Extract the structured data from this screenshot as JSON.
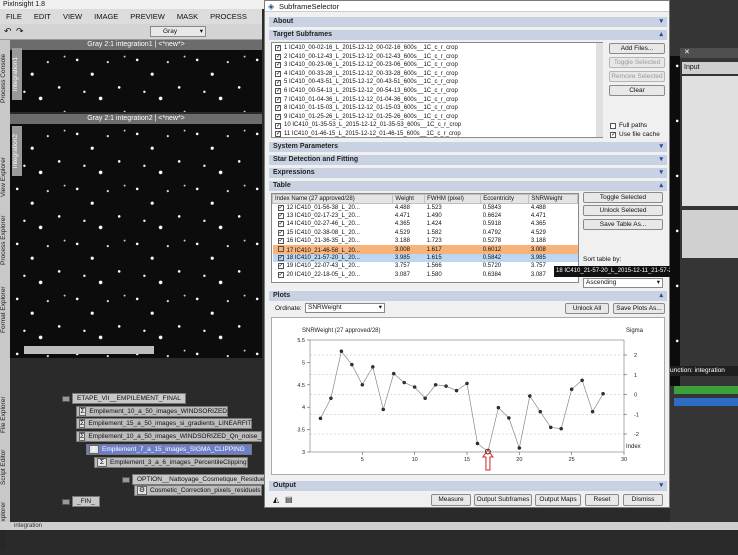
{
  "app": {
    "title": "PixInsight 1.8"
  },
  "menu": [
    "FILE",
    "EDIT",
    "VIEW",
    "IMAGE",
    "PREVIEW",
    "MASK",
    "PROCESS"
  ],
  "toolbar": {
    "colorspace": "Gray"
  },
  "side_tabs": [
    "Process Console",
    "View Explorer",
    "Process Explorer",
    "Format Explorer",
    "File Explorer",
    "Script Editor",
    "History Explorer"
  ],
  "image_windows": [
    {
      "title": "Gray 2:1 integration1 | <*new*>",
      "tab": "integration1"
    },
    {
      "title": "Gray 2:1 integration2 | <*new*>",
      "tab": "integration2"
    }
  ],
  "process_container": {
    "header": "ETAPE_VII__EMPILEMENT_FINAL",
    "items": [
      {
        "label": "Empilement_10_a_50_images_WINDSORIZED"
      },
      {
        "label": "Empilement_15_a_50_images_si_gradients_LINEARFIT"
      },
      {
        "label": "Empilement_10_a_50_images_WINDSORIZED_Qn_noise_"
      },
      {
        "label": "Empilement_7_a_15_images_SIGMA_CLIPPING"
      },
      {
        "label": "Empilement_3_a_6_images_PercentileClipping"
      }
    ],
    "option_header": "OPTION__Nattoyage_Cosmetique_Residuel",
    "option_item": "Cosmetic_Correction_pixels_residuels",
    "fin": "_FIN_"
  },
  "dialog": {
    "title": "SubframeSelector",
    "sections": {
      "about": "About",
      "target": "Target Subframes",
      "params": "System Parameters",
      "star": "Star Detection and Fitting",
      "expr": "Expressions",
      "table": "Table",
      "plots": "Plots",
      "output": "Output"
    },
    "subframes": [
      "1 IC410_00-02-16_L_2015-12-12_00-02-16_600s__1C_c_r_crop",
      "2 IC410_00-12-43_L_2015-12-12_00-12-43_600s__1C_c_r_crop",
      "3 IC410_00-23-06_L_2015-12-12_00-23-06_600s__1C_c_r_crop",
      "4 IC410_00-33-28_L_2015-12-12_00-33-28_600s__1C_c_r_crop",
      "5 IC410_00-43-51_L_2015-12-12_00-43-51_600s__1C_c_r_crop",
      "6 IC410_00-54-13_L_2015-12-12_00-54-13_600s__1C_c_r_crop",
      "7 IC410_01-04-36_L_2015-12-12_01-04-36_600s__1C_c_r_crop",
      "8 IC410_01-15-03_L_2015-12-12_01-15-03_600s__1C_c_r_crop",
      "9 IC410_01-25-26_L_2015-12-12_01-25-26_600s__1C_c_r_crop",
      "10 IC410_01-35-53_L_2015-12-12_01-35-53_600s__1C_c_r_crop",
      "11 IC410_01-46-15_L_2015-12-12_01-46-15_600s__1C_c_r_crop"
    ],
    "buttons": {
      "add_files": "Add Files...",
      "toggle_selected": "Toggle Selected",
      "remove_selected": "Remove Selected",
      "clear": "Clear",
      "toggle_selected2": "Toggle Selected",
      "unlock_selected": "Unlock Selected",
      "save_table": "Save Table As...",
      "unlock_all": "Unlock All",
      "save_plots": "Save Plots As...",
      "measure": "Measure",
      "output_subframes": "Output Subframes",
      "output_maps": "Output Maps",
      "reset": "Reset",
      "dismiss": "Dismiss"
    },
    "full_paths": "Full paths",
    "file_cache": "Use file cache",
    "table_headers": [
      "Index Name (27 approved/28)",
      "Weight",
      "FWHM (pixel)",
      "Eccentricity",
      "SNRWeight"
    ],
    "table_rows": [
      {
        "check": true,
        "idx": "12 IC410_01-56-38_L_20...",
        "w": "4.488",
        "fwhm": "1.523",
        "ecc": "0.5843",
        "snr": "4.488"
      },
      {
        "check": true,
        "idx": "13 IC410_02-17-23_L_20...",
        "w": "4.471",
        "fwhm": "1.490",
        "ecc": "0.6624",
        "snr": "4.471"
      },
      {
        "check": true,
        "idx": "14 IC410_02-27-46_L_20...",
        "w": "4.365",
        "fwhm": "1.424",
        "ecc": "0.5918",
        "snr": "4.365"
      },
      {
        "check": true,
        "idx": "15 IC410_02-38-08_L_20...",
        "w": "4.529",
        "fwhm": "1.582",
        "ecc": "0.4792",
        "snr": "4.529"
      },
      {
        "check": true,
        "idx": "16 IC410_21-36-35_L_20...",
        "w": "3.188",
        "fwhm": "1.723",
        "ecc": "0.5278",
        "snr": "3.188"
      },
      {
        "check": false,
        "idx": "17 IC410_21-46-58_L_20...",
        "w": "3.008",
        "fwhm": "1.617",
        "ecc": "0.6012",
        "snr": "3.008"
      },
      {
        "check": true,
        "idx": "18 IC410_21-57-20_L_20...",
        "w": "3.985",
        "fwhm": "1.615",
        "ecc": "0.5842",
        "snr": "3.985"
      },
      {
        "check": true,
        "idx": "19 IC410_22-07-43_L_20...",
        "w": "3.757",
        "fwhm": "1.566",
        "ecc": "0.5720",
        "snr": "3.757"
      },
      {
        "check": true,
        "idx": "20 IC410_22-18-05_L_20...",
        "w": "3.087",
        "fwhm": "1.580",
        "ecc": "0.6384",
        "snr": "3.087"
      }
    ],
    "sort_label": "Sort table by:",
    "sort_order": "Ascending",
    "tooltip": "18 IC410_21-57-20_L_2015-12-11_21-57-20_600s__1C_c_r_crop",
    "ordinate_label": "Ordinate:",
    "ordinate_value": "SNRWeight"
  },
  "right_pane": {
    "label": "Input",
    "function_label": "unction: integration"
  },
  "status": {
    "view": "integration"
  },
  "chart_data": {
    "type": "line",
    "title": "SNRWeight (27 approved/28)",
    "xlabel": "Index",
    "right_label": "Sigma",
    "x": [
      1,
      2,
      3,
      4,
      5,
      6,
      7,
      8,
      9,
      10,
      11,
      12,
      13,
      14,
      15,
      16,
      17,
      18,
      19,
      20,
      21,
      22,
      23,
      24,
      25,
      26,
      27,
      28
    ],
    "values": [
      3.75,
      4.2,
      5.25,
      4.95,
      4.5,
      4.9,
      3.95,
      4.75,
      4.55,
      4.45,
      4.2,
      4.5,
      4.47,
      4.37,
      4.53,
      3.19,
      3.01,
      3.99,
      3.76,
      3.09,
      4.25,
      3.9,
      3.55,
      3.52,
      4.4,
      4.6,
      3.9,
      4.3
    ],
    "rejected_index": 17,
    "xlim": [
      0,
      30
    ],
    "ylim": [
      3.0,
      5.5
    ],
    "xticks": [
      5,
      10,
      15,
      20,
      25,
      30
    ],
    "yticks": [
      3.0,
      3.5,
      4.0,
      4.5,
      5.0,
      5.5
    ],
    "sigma_ticks": [
      2,
      1,
      0,
      -1,
      -2
    ]
  }
}
